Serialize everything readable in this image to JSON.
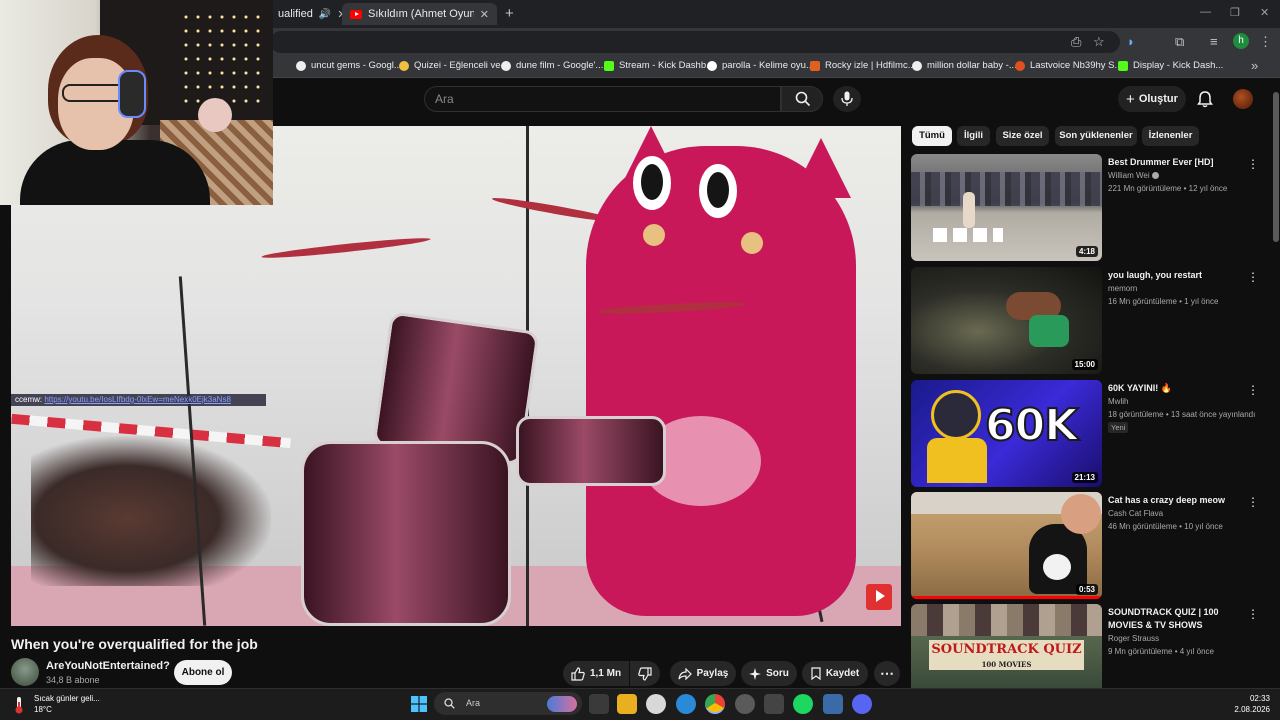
{
  "browser": {
    "tabs": [
      {
        "label": "ualified"
      },
      {
        "label": "Sıkıldım (Ahmet Oyunda Silinen"
      }
    ],
    "bookmarks": [
      {
        "label": "uncut gems - Googl..."
      },
      {
        "label": "Quizei - Eğlenceli ve..."
      },
      {
        "label": "dune film - Google'..."
      },
      {
        "label": "Stream - Kick Dashb..."
      },
      {
        "label": "parolla - Kelime oyu..."
      },
      {
        "label": "Rocky izle | Hdfilmc..."
      },
      {
        "label": "million dollar baby -..."
      },
      {
        "label": "Lastvoice Nb39hy S..."
      },
      {
        "label": "Display - Kick Dash..."
      }
    ],
    "profile_initial": "h"
  },
  "youtube": {
    "search_placeholder": "Ara",
    "create_label": "Oluştur",
    "video": {
      "title": "When you're overqualified for the job",
      "overlay_user": "ccemw:",
      "overlay_link": "https://youtu.be/IosLIfbdg-0lxEw=meNexk0Ejk3aNs8"
    },
    "channel": {
      "name": "AreYouNotEntertained?",
      "subscribers": "34,8 B abone",
      "subscribe_label": "Abone ol"
    },
    "actions": {
      "likes": "1,1 Mn",
      "share": "Paylaş",
      "ask": "Soru",
      "save": "Kaydet"
    },
    "chips": [
      "Tümü",
      "İlgili",
      "Size özel",
      "Son yüklenenler",
      "İzlenenler"
    ],
    "recommendations": [
      {
        "title": "Best Drummer Ever [HD]",
        "channel": "William Wei",
        "meta": "221 Mn görüntüleme • 12 yıl önce",
        "duration": "4:18"
      },
      {
        "title": "you laugh, you restart",
        "channel": "memorn",
        "meta": "16 Mn görüntüleme • 1 yıl önce",
        "duration": "15:00"
      },
      {
        "title": "60K YAYINI! 🔥",
        "channel": "Mwlih",
        "meta": "18 görüntüleme • 13 saat önce yayınlandı",
        "badge": "Yeni",
        "duration": "21:13",
        "thumb_text": "60K"
      },
      {
        "title": "Cat has a crazy deep meow",
        "channel": "Cash Cat Flava",
        "meta": "46 Mn görüntüleme • 10 yıl önce",
        "duration": "0:53"
      },
      {
        "title": "SOUNDTRACK QUIZ | 100 MOVIES & TV SHOWS",
        "channel": "Roger Strauss",
        "meta": "9 Mn görüntüleme • 4 yıl önce",
        "thumb_text": "SOUNDTRACK QUIZ",
        "thumb_sub": "100 MOVIES"
      }
    ]
  },
  "taskbar": {
    "weather_title": "Sıcak günler geli...",
    "weather_temp": "18°C",
    "search_placeholder": "Ara",
    "time": "02:33",
    "date": "2.08.2026"
  },
  "colors": {
    "yt_red": "#ff0000",
    "mascot": "#c8185a",
    "background": "#0f0f0f"
  }
}
